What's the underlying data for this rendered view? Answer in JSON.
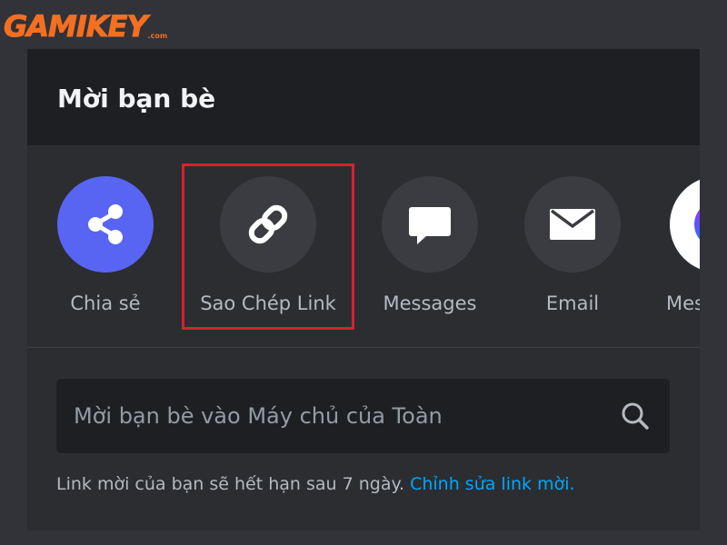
{
  "watermark": {
    "logo_text": "GAMIKEY",
    "logo_suffix": ".com"
  },
  "dialog": {
    "title": "Mời bạn bè"
  },
  "share_options": [
    {
      "label": "Chia sẻ",
      "icon": "share-icon"
    },
    {
      "label": "Sao Chép Link",
      "icon": "link-icon"
    },
    {
      "label": "Messages",
      "icon": "chat-bubble-icon"
    },
    {
      "label": "Email",
      "icon": "envelope-icon"
    },
    {
      "label": "Messenger",
      "icon": "messenger-icon"
    }
  ],
  "search": {
    "placeholder": "Mời bạn bè vào Máy chủ của Toàn"
  },
  "footer": {
    "note": "Link mời của bạn sẽ hết hạn sau 7 ngày.",
    "edit_link": "Chỉnh sửa link mời."
  },
  "colors": {
    "background": "#313338",
    "panel": "#2b2d31",
    "header": "#1e1f22",
    "accent": "#5865f2",
    "link": "#00a8fc",
    "highlight": "#d7212d",
    "brand": "#f36f21"
  }
}
